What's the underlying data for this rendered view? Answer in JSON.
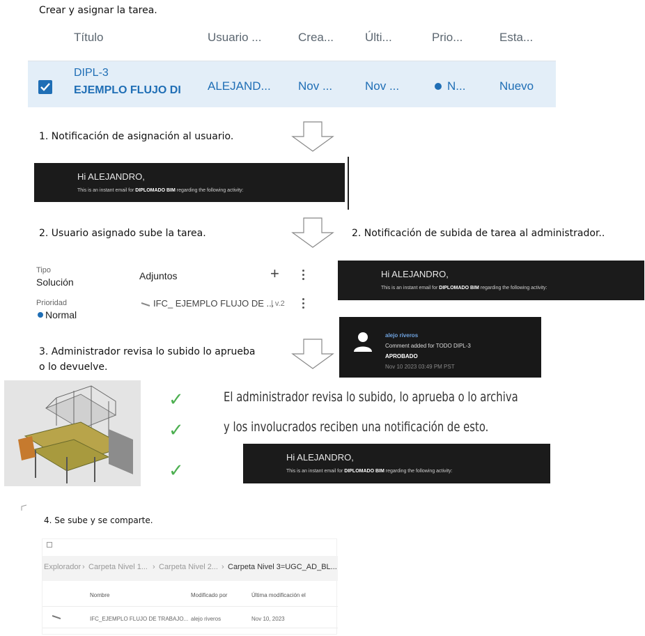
{
  "intro": {
    "title": "Crear y asignar la tarea."
  },
  "task_table": {
    "columns": [
      "Título",
      "Usuario ...",
      "Crea...",
      "Últi...",
      "Prio...",
      "Esta..."
    ],
    "row": {
      "id": "DIPL-3",
      "name": "EJEMPLO FLUJO DI",
      "user": "ALEJAND...",
      "created": "Nov ...",
      "updated": "Nov ...",
      "priority": "N...",
      "status": "Nuevo"
    }
  },
  "steps": {
    "step1": "1. Notificación de asignación al usuario.",
    "step2_user": "2. Usuario asignado sube la tarea.",
    "step2_admin": "2. Notificación de subida de tarea al administrador..",
    "step3_line1": "3. Administrador revisa lo subido lo aprueba",
    "step3_line2": "o lo devuelve.",
    "step4": "4. Se sube y se comparte."
  },
  "email": {
    "greeting": "Hi ALEJANDRO,",
    "body_pre": "This is an instant email for ",
    "body_org": "DIPLOMADO BIM",
    "body_post": " regarding the following activity:"
  },
  "attachments": {
    "type_label": "Tipo",
    "type_value": "Solución",
    "priority_label": "Prioridad",
    "priority_value": "Normal",
    "section_title": "Adjuntos",
    "add_symbol": "+",
    "file_name": "IFC_ EJEMPLO FLUJO DE ...",
    "file_version": "| v.2"
  },
  "comment": {
    "author": "alejo riveros",
    "text": "Comment added for TODO DIPL-3",
    "status": "APROBADO",
    "date": "Nov 10 2023 03:49 PM PST"
  },
  "review": {
    "line1": "El administrador revisa lo subido, lo aprueba o lo archiva",
    "line2": "y los involucrados reciben una notificación de esto."
  },
  "explorer": {
    "breadcrumbs": [
      "Explorador",
      "Carpeta Nivel 1...",
      "Carpeta Nivel 2...",
      "Carpeta Nivel 3=UGC_AD_BL..."
    ],
    "separator": "›",
    "columns": [
      "Nombre",
      "Modificado por",
      "Última modificación el"
    ],
    "row": {
      "name": "IFC_EJEMPLO FLUJO DE TRABAJO...",
      "modified_by": "alejo riveros",
      "modified_on": "Nov 10, 2023"
    }
  },
  "colors": {
    "accent": "#1f6eb5",
    "row_selected": "#e3eef8",
    "email_bg": "#1b1b1b",
    "check": "#4caf50"
  }
}
